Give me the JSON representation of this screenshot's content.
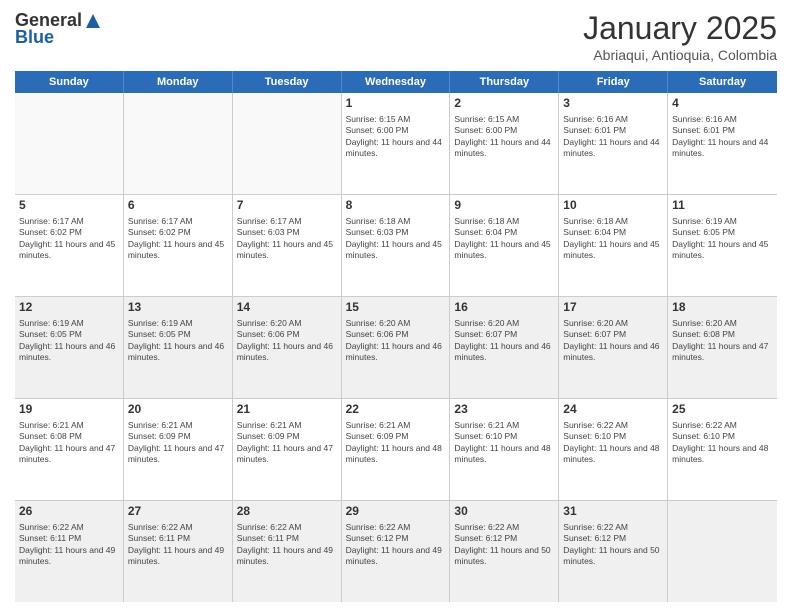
{
  "header": {
    "logo_general": "General",
    "logo_blue": "Blue",
    "title": "January 2025",
    "subtitle": "Abriaqui, Antioquia, Colombia"
  },
  "days_of_week": [
    "Sunday",
    "Monday",
    "Tuesday",
    "Wednesday",
    "Thursday",
    "Friday",
    "Saturday"
  ],
  "weeks": [
    [
      {
        "day": "",
        "info": "",
        "empty": true
      },
      {
        "day": "",
        "info": "",
        "empty": true
      },
      {
        "day": "",
        "info": "",
        "empty": true
      },
      {
        "day": "1",
        "info": "Sunrise: 6:15 AM\nSunset: 6:00 PM\nDaylight: 11 hours and 44 minutes."
      },
      {
        "day": "2",
        "info": "Sunrise: 6:15 AM\nSunset: 6:00 PM\nDaylight: 11 hours and 44 minutes."
      },
      {
        "day": "3",
        "info": "Sunrise: 6:16 AM\nSunset: 6:01 PM\nDaylight: 11 hours and 44 minutes."
      },
      {
        "day": "4",
        "info": "Sunrise: 6:16 AM\nSunset: 6:01 PM\nDaylight: 11 hours and 44 minutes."
      }
    ],
    [
      {
        "day": "5",
        "info": "Sunrise: 6:17 AM\nSunset: 6:02 PM\nDaylight: 11 hours and 45 minutes."
      },
      {
        "day": "6",
        "info": "Sunrise: 6:17 AM\nSunset: 6:02 PM\nDaylight: 11 hours and 45 minutes."
      },
      {
        "day": "7",
        "info": "Sunrise: 6:17 AM\nSunset: 6:03 PM\nDaylight: 11 hours and 45 minutes."
      },
      {
        "day": "8",
        "info": "Sunrise: 6:18 AM\nSunset: 6:03 PM\nDaylight: 11 hours and 45 minutes."
      },
      {
        "day": "9",
        "info": "Sunrise: 6:18 AM\nSunset: 6:04 PM\nDaylight: 11 hours and 45 minutes."
      },
      {
        "day": "10",
        "info": "Sunrise: 6:18 AM\nSunset: 6:04 PM\nDaylight: 11 hours and 45 minutes."
      },
      {
        "day": "11",
        "info": "Sunrise: 6:19 AM\nSunset: 6:05 PM\nDaylight: 11 hours and 45 minutes."
      }
    ],
    [
      {
        "day": "12",
        "info": "Sunrise: 6:19 AM\nSunset: 6:05 PM\nDaylight: 11 hours and 46 minutes.",
        "shaded": true
      },
      {
        "day": "13",
        "info": "Sunrise: 6:19 AM\nSunset: 6:05 PM\nDaylight: 11 hours and 46 minutes.",
        "shaded": true
      },
      {
        "day": "14",
        "info": "Sunrise: 6:20 AM\nSunset: 6:06 PM\nDaylight: 11 hours and 46 minutes.",
        "shaded": true
      },
      {
        "day": "15",
        "info": "Sunrise: 6:20 AM\nSunset: 6:06 PM\nDaylight: 11 hours and 46 minutes.",
        "shaded": true
      },
      {
        "day": "16",
        "info": "Sunrise: 6:20 AM\nSunset: 6:07 PM\nDaylight: 11 hours and 46 minutes.",
        "shaded": true
      },
      {
        "day": "17",
        "info": "Sunrise: 6:20 AM\nSunset: 6:07 PM\nDaylight: 11 hours and 46 minutes.",
        "shaded": true
      },
      {
        "day": "18",
        "info": "Sunrise: 6:20 AM\nSunset: 6:08 PM\nDaylight: 11 hours and 47 minutes.",
        "shaded": true
      }
    ],
    [
      {
        "day": "19",
        "info": "Sunrise: 6:21 AM\nSunset: 6:08 PM\nDaylight: 11 hours and 47 minutes."
      },
      {
        "day": "20",
        "info": "Sunrise: 6:21 AM\nSunset: 6:09 PM\nDaylight: 11 hours and 47 minutes."
      },
      {
        "day": "21",
        "info": "Sunrise: 6:21 AM\nSunset: 6:09 PM\nDaylight: 11 hours and 47 minutes."
      },
      {
        "day": "22",
        "info": "Sunrise: 6:21 AM\nSunset: 6:09 PM\nDaylight: 11 hours and 48 minutes."
      },
      {
        "day": "23",
        "info": "Sunrise: 6:21 AM\nSunset: 6:10 PM\nDaylight: 11 hours and 48 minutes."
      },
      {
        "day": "24",
        "info": "Sunrise: 6:22 AM\nSunset: 6:10 PM\nDaylight: 11 hours and 48 minutes."
      },
      {
        "day": "25",
        "info": "Sunrise: 6:22 AM\nSunset: 6:10 PM\nDaylight: 11 hours and 48 minutes."
      }
    ],
    [
      {
        "day": "26",
        "info": "Sunrise: 6:22 AM\nSunset: 6:11 PM\nDaylight: 11 hours and 49 minutes.",
        "shaded": true
      },
      {
        "day": "27",
        "info": "Sunrise: 6:22 AM\nSunset: 6:11 PM\nDaylight: 11 hours and 49 minutes.",
        "shaded": true
      },
      {
        "day": "28",
        "info": "Sunrise: 6:22 AM\nSunset: 6:11 PM\nDaylight: 11 hours and 49 minutes.",
        "shaded": true
      },
      {
        "day": "29",
        "info": "Sunrise: 6:22 AM\nSunset: 6:12 PM\nDaylight: 11 hours and 49 minutes.",
        "shaded": true
      },
      {
        "day": "30",
        "info": "Sunrise: 6:22 AM\nSunset: 6:12 PM\nDaylight: 11 hours and 50 minutes.",
        "shaded": true
      },
      {
        "day": "31",
        "info": "Sunrise: 6:22 AM\nSunset: 6:12 PM\nDaylight: 11 hours and 50 minutes.",
        "shaded": true
      },
      {
        "day": "",
        "info": "",
        "empty": true,
        "shaded": true
      }
    ]
  ]
}
